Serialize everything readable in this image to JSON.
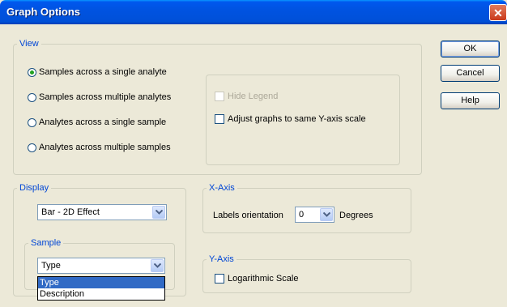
{
  "window": {
    "title": "Graph Options",
    "close_glyph": "✕"
  },
  "buttons": {
    "ok": "OK",
    "cancel": "Cancel",
    "help": "Help"
  },
  "view": {
    "legend": "View",
    "options": [
      "Samples across a single analyte",
      "Samples across multiple analytes",
      "Analytes across a single sample",
      "Analytes across multiple samples"
    ],
    "selected_index": 0,
    "hide_legend": "Hide Legend",
    "adjust_scale": "Adjust graphs to same Y-axis scale"
  },
  "display": {
    "legend": "Display",
    "value": "Bar - 2D Effect",
    "sample": {
      "legend": "Sample",
      "value": "Type",
      "options": [
        "Type",
        "Description"
      ],
      "highlighted_index": 0
    }
  },
  "xaxis": {
    "legend": "X-Axis",
    "label": "Labels orientation",
    "value": "0",
    "suffix": "Degrees"
  },
  "yaxis": {
    "legend": "Y-Axis",
    "log_label": "Logarithmic Scale"
  }
}
